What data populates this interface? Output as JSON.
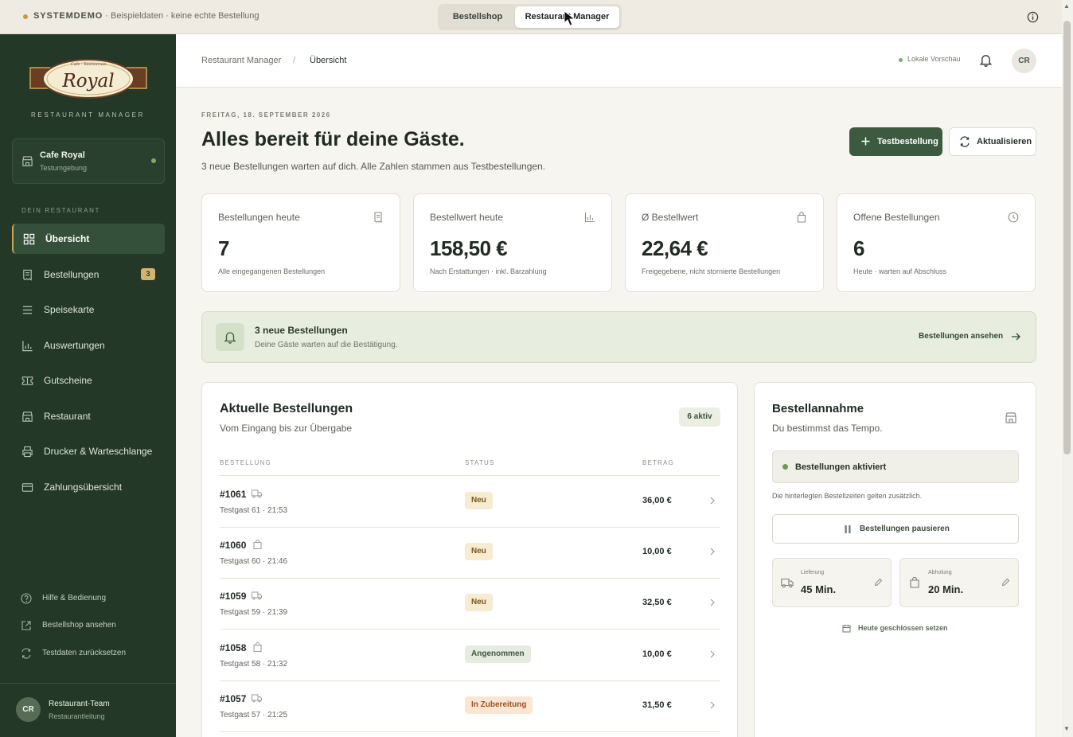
{
  "demo_bar": {
    "system_label": "SYSTEMDEMO",
    "description": " · Beispieldaten · keine echte Bestellung",
    "switch_shop": "Bestellshop",
    "switch_manager": "Restaurant Manager"
  },
  "sidebar": {
    "subtitle": "RESTAURANT MANAGER",
    "restaurant": {
      "name": "Cafe Royal",
      "environment": "Testumgebung"
    },
    "section_label": "DEIN RESTAURANT",
    "items": [
      {
        "label": "Übersicht",
        "icon": "grid-icon"
      },
      {
        "label": "Bestellungen",
        "icon": "receipt-icon",
        "badge": "3"
      },
      {
        "label": "Speisekarte",
        "icon": "menu-lines-icon"
      },
      {
        "label": "Auswertungen",
        "icon": "bar-chart-icon"
      },
      {
        "label": "Gutscheine",
        "icon": "ticket-icon"
      },
      {
        "label": "Restaurant",
        "icon": "store-icon"
      },
      {
        "label": "Drucker & Warteschlange",
        "icon": "printer-icon"
      },
      {
        "label": "Zahlungsübersicht",
        "icon": "card-icon"
      }
    ],
    "footer_links": [
      {
        "label": "Hilfe & Bedienung",
        "icon": "help-icon"
      },
      {
        "label": "Bestellshop ansehen",
        "icon": "external-link-icon"
      },
      {
        "label": "Testdaten zurücksetzen",
        "icon": "refresh-icon"
      }
    ],
    "user": {
      "initials": "CR",
      "name": "Restaurant-Team",
      "role": "Restaurantleitung"
    }
  },
  "header": {
    "breadcrumb_root": "Restaurant Manager",
    "breadcrumb_separator": "/",
    "breadcrumb_current": "Übersicht",
    "preview_label": "Lokale Vorschau",
    "avatar_initials": "CR"
  },
  "main": {
    "date": "FREITAG, 18. SEPTEMBER 2026",
    "title": "Alles bereit für deine Gäste.",
    "subtitle": "3 neue Bestellungen warten auf dich. Alle Zahlen stammen aus Testbestellungen.",
    "btn_test_order": "Testbestellung",
    "btn_refresh": "Aktualisieren",
    "stats": [
      {
        "label": "Bestellungen heute",
        "value": "7",
        "note": "Alle eingegangenen Bestellungen",
        "icon": "receipt-icon"
      },
      {
        "label": "Bestellwert heute",
        "value": "158,50 €",
        "note": "Nach Erstattungen · inkl. Barzahlung",
        "icon": "bar-chart-icon"
      },
      {
        "label": "Ø Bestellwert",
        "value": "22,64 €",
        "note": "Freigegebene, nicht stornierte Bestellungen",
        "icon": "bag-icon"
      },
      {
        "label": "Offene Bestellungen",
        "value": "6",
        "note": "Heute · warten auf Abschluss",
        "icon": "clock-icon"
      }
    ],
    "alert": {
      "title": "3 neue Bestellungen",
      "text": "Deine Gäste warten auf die Bestätigung.",
      "link": "Bestellungen ansehen"
    },
    "orders": {
      "title": "Aktuelle Bestellungen",
      "subtitle": "Vom Eingang bis zur Übergabe",
      "active_badge": "6 aktiv",
      "columns": [
        "BESTELLUNG",
        "STATUS",
        "BETRAG"
      ],
      "rows": [
        {
          "id": "#1061",
          "type": "delivery",
          "meta": "Testgast 61 · 21:53",
          "status": "Neu",
          "status_kind": "neu",
          "amount": "36,00 €"
        },
        {
          "id": "#1060",
          "type": "pickup",
          "meta": "Testgast 60 · 21:46",
          "status": "Neu",
          "status_kind": "neu",
          "amount": "10,00 €"
        },
        {
          "id": "#1059",
          "type": "delivery",
          "meta": "Testgast 59 · 21:39",
          "status": "Neu",
          "status_kind": "neu",
          "amount": "32,50 €"
        },
        {
          "id": "#1058",
          "type": "pickup",
          "meta": "Testgast 58 · 21:32",
          "status": "Angenommen",
          "status_kind": "ang",
          "amount": "10,00 €"
        },
        {
          "id": "#1057",
          "type": "delivery",
          "meta": "Testgast 57 · 21:25",
          "status": "In Zubereitung",
          "status_kind": "zub",
          "amount": "31,50 €"
        }
      ]
    },
    "acceptance": {
      "title": "Bestellannahme",
      "subtitle": "Du bestimmst das Tempo.",
      "status": "Bestellungen aktiviert",
      "note": "Die hinterlegten Bestellzeiten gelten zusätzlich.",
      "pause_button": "Bestellungen pausieren",
      "delivery_label": "Lieferung",
      "delivery_time": "45 Min.",
      "pickup_label": "Abholung",
      "pickup_time": "20 Min.",
      "closed_link": "Heute geschlossen setzen"
    }
  },
  "colors": {
    "sidebar_bg": "#233827",
    "accent_green": "#3b5a3f",
    "badge_gold": "#d2b56c",
    "alert_bg": "#e8eedf"
  }
}
